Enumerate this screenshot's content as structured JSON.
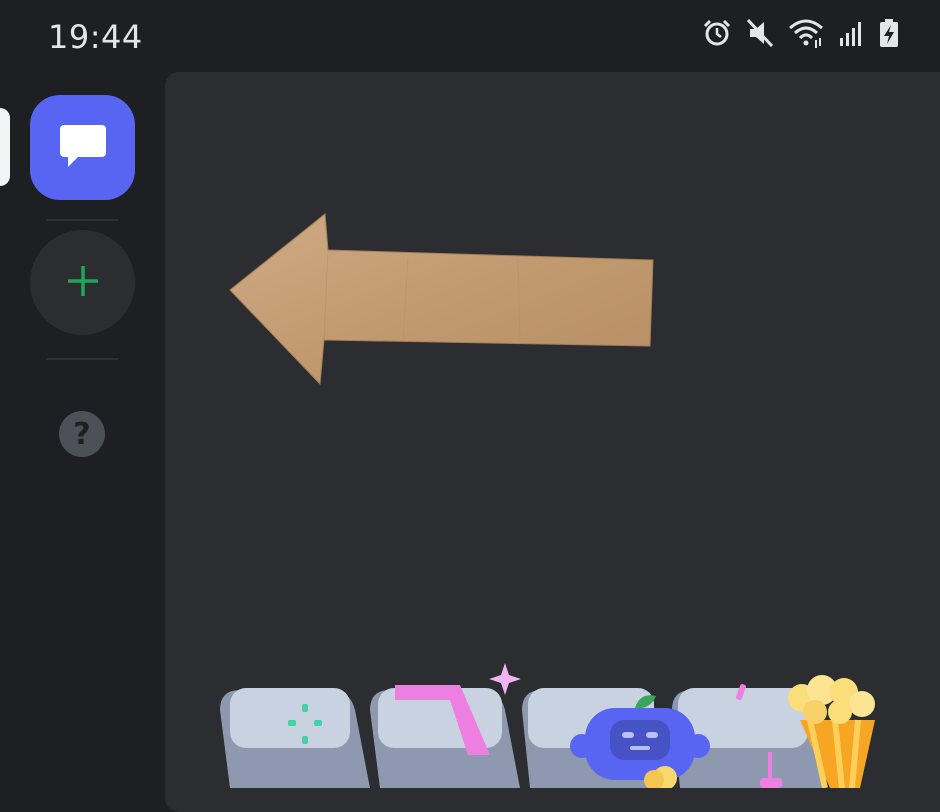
{
  "status_bar": {
    "time": "19:44",
    "icons": [
      "alarm-icon",
      "mute-icon",
      "wifi-icon",
      "signal-icon",
      "battery-charging-icon"
    ]
  },
  "sidebar": {
    "items": [
      {
        "name": "direct-messages",
        "icon": "chat-bubble-icon",
        "selected": true
      },
      {
        "name": "add-server",
        "icon": "plus-icon"
      },
      {
        "name": "help",
        "icon": "question-icon",
        "label": "?"
      }
    ]
  },
  "colors": {
    "blurple": "#5865f2",
    "add_green": "#23a559",
    "rail_bg": "#1e1f22",
    "panel_bg": "#2b2d31",
    "arrow_paper": "#c9a27a"
  }
}
